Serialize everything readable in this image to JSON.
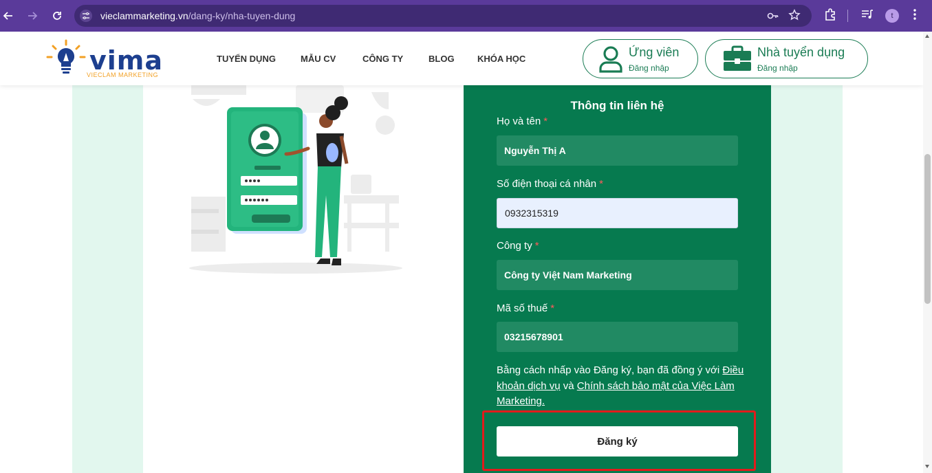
{
  "browser": {
    "url_host": "vieclammarketing.vn",
    "url_path": "/dang-ky/nha-tuyen-dung",
    "profile_initial": "t",
    "icons": [
      "back-icon",
      "forward-icon",
      "reload-icon",
      "site-info-icon",
      "password-key-icon",
      "bookmark-star-icon",
      "extensions-icon",
      "media-playlist-icon",
      "menu-dots-icon"
    ]
  },
  "header": {
    "logo_text": "vima",
    "logo_subtitle": "VIECLAM MARKETING",
    "menu": [
      "TUYỂN DỤNG",
      "MẪU CV",
      "CÔNG TY",
      "BLOG",
      "KHÓA HỌC"
    ],
    "candidate_button": {
      "title": "Ứng viên",
      "subtitle": "Đăng nhập",
      "icon": "user-icon"
    },
    "employer_button": {
      "title": "Nhà tuyển dụng",
      "subtitle": "Đăng nhập",
      "icon": "briefcase-icon"
    }
  },
  "form": {
    "title": "Thông tin liên hệ",
    "fields": [
      {
        "label": "Họ và tên",
        "required": "*",
        "value": "Nguyễn Thị A"
      },
      {
        "label": "Số điện thoại cá nhân",
        "required": "*",
        "value": "0932315319",
        "autofilled": true
      },
      {
        "label": "Công ty",
        "required": "*",
        "value": "Công ty Việt Nam Marketing"
      },
      {
        "label": "Mã số thuế",
        "required": "*",
        "value": "03215678901"
      }
    ],
    "terms_prefix": "Bằng cách nhấp vào Đăng ký, bạn đã đồng ý với ",
    "terms_link": "Điều khoản dịch vụ",
    "terms_middle": " và ",
    "privacy_link": "Chính sách bảo mật của Việc Làm Marketing.",
    "submit_label": "Đăng ký"
  },
  "colors": {
    "brand_green": "#067a4f",
    "field_green": "#218a63",
    "highlight_red": "#e31b1b",
    "browser_purple": "#5a3a9a",
    "logo_blue": "#1d3f8f",
    "logo_orange": "#f2a024"
  }
}
